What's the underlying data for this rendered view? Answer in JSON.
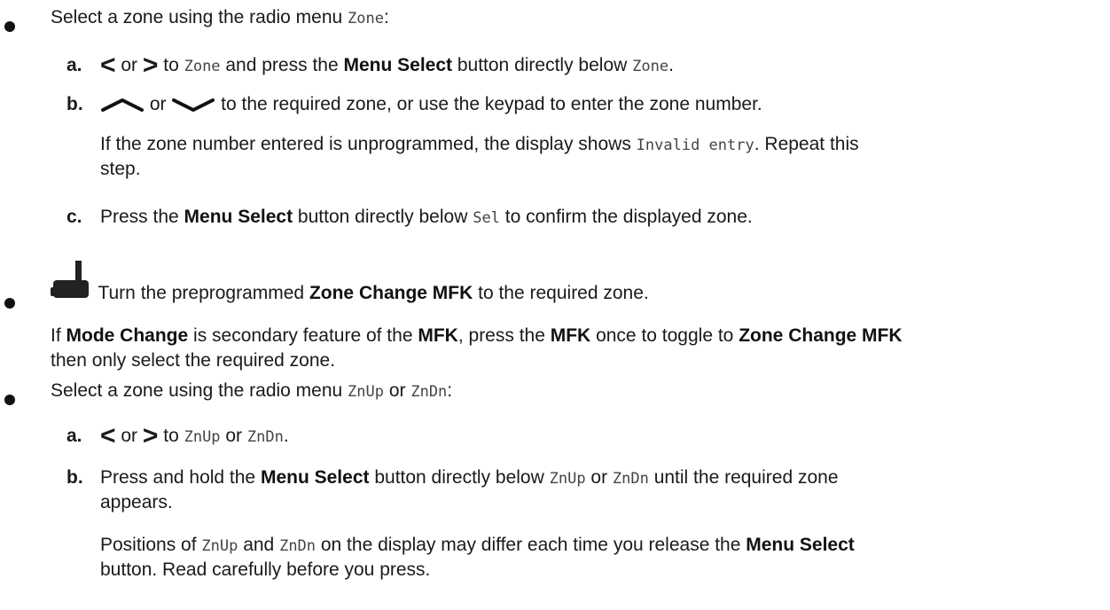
{
  "bullet1": {
    "text_a": "Select a zone using the radio menu ",
    "code_zone": "Zone",
    "text_b": ":",
    "steps": {
      "a": {
        "letter": "a.",
        "left_glyph": "<",
        "or1": " or ",
        "right_glyph": ">",
        "to": " to ",
        "code": "Zone",
        "text1": " and press the ",
        "bold": "Menu Select",
        "text2": " button directly below ",
        "code2": "Zone",
        "end": "."
      },
      "b": {
        "letter": "b.",
        "or": " or ",
        "text": " to the required zone, or use the keypad to enter the zone number.",
        "note_a": "If the zone number entered is unprogrammed, the display shows ",
        "note_code": "Invalid entry",
        "note_b": ". Repeat this",
        "note_c": "step."
      },
      "c": {
        "letter": "c.",
        "text1": "Press the ",
        "bold": "Menu Select",
        "text2": " button directly below ",
        "code": "Sel",
        "text3": " to confirm the displayed zone."
      }
    }
  },
  "bullet2": {
    "text1": " Turn the preprogrammed ",
    "bold": "Zone Change MFK",
    "text2": " to the required zone.",
    "note_t1": "If ",
    "note_b1": "Mode Change",
    "note_t2": " is secondary feature of the ",
    "note_b2": "MFK",
    "note_t3": ", press the ",
    "note_b3": "MFK",
    "note_t4": " once to toggle to ",
    "note_b4": "Zone Change MFK",
    "note_line2": "then only select the required zone."
  },
  "bullet3": {
    "text_a": "Select a zone using the radio menu ",
    "code1": "ZnUp",
    "or": " or ",
    "code2": "ZnDn",
    "text_b": ":",
    "steps": {
      "a": {
        "letter": "a.",
        "left_glyph": "<",
        "or1": " or ",
        "right_glyph": ">",
        "to": " to ",
        "code1": "ZnUp",
        "or2": " or ",
        "code2": "ZnDn",
        "end": "."
      },
      "b": {
        "letter": "b.",
        "text1": "Press and hold the ",
        "bold": "Menu Select",
        "text2": " button directly below ",
        "code1": "ZnUp",
        "or": " or ",
        "code2": "ZnDn",
        "text3": " until the required zone",
        "line2": "appears.",
        "note_t1": "Positions of ",
        "note_c1": "ZnUp",
        "note_and": " and ",
        "note_c2": "ZnDn",
        "note_t2": " on the display may differ each time you release the ",
        "note_bold": "Menu Select",
        "note_line2": "button. Read carefully before you press."
      }
    }
  }
}
